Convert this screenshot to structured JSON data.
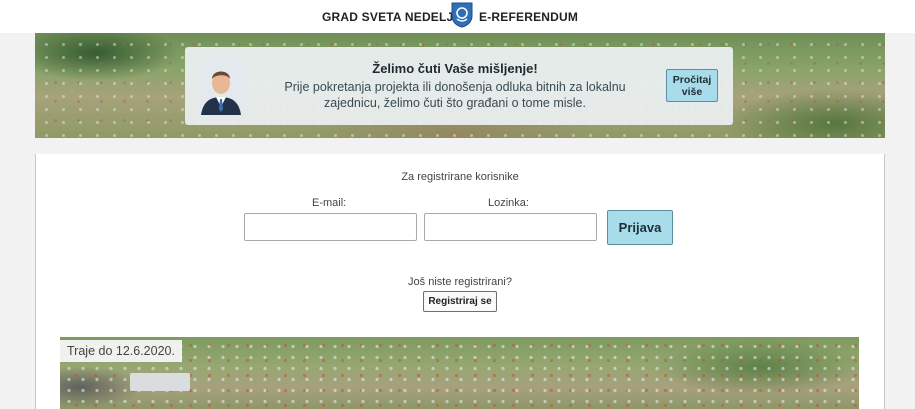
{
  "header": {
    "left_title": "GRAD SVETA NEDELJA",
    "right_title": "E-REFERENDUM",
    "logo_icon": "city-crest-icon"
  },
  "hero": {
    "title": "Želimo čuti Vaše mišljenje!",
    "text": "Prije pokretanja projekta ili donošenja odluka bitnih za lokalnu zajednicu, želimo čuti što građani o tome misle.",
    "read_more_label": "Pročitaj više",
    "accent_color": "#a9dcea"
  },
  "login": {
    "section_title": "Za registrirane korisnike",
    "email_label": "E-mail:",
    "email_value": "",
    "password_label": "Lozinka:",
    "password_value": "",
    "submit_label": "Prijava"
  },
  "register": {
    "prompt": "Još niste registrirani?",
    "button_label": "Registriraj se"
  },
  "poll": {
    "duration_text": "Traje do 12.6.2020."
  }
}
